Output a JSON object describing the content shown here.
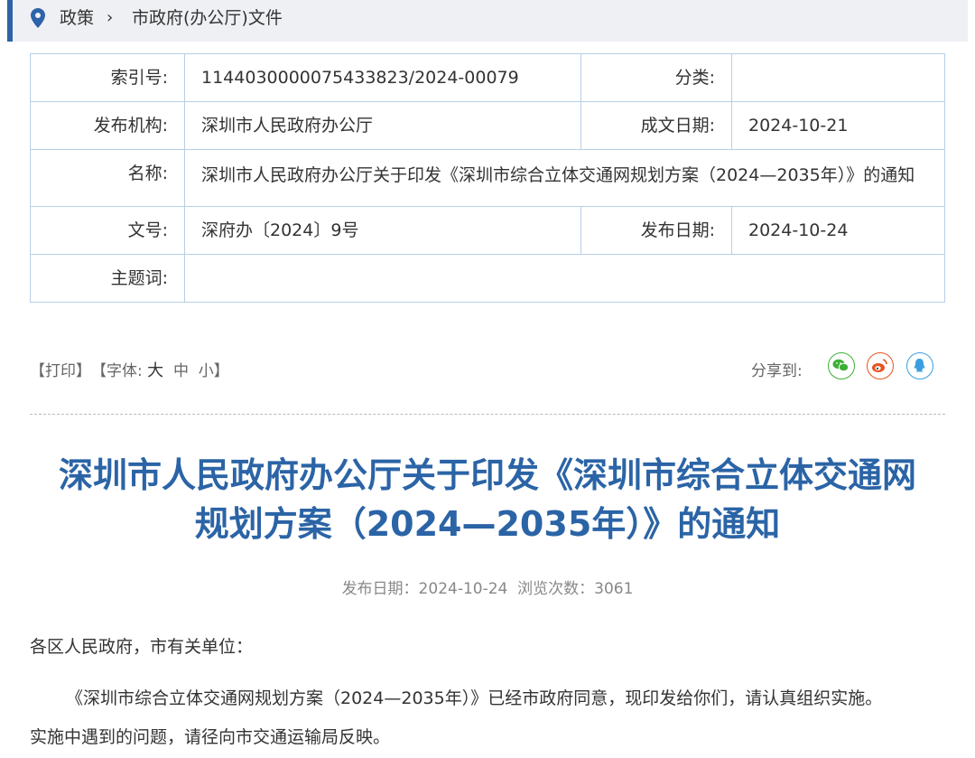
{
  "breadcrumb": {
    "items": [
      "政策",
      "市政府(办公厅)文件"
    ],
    "separator": "›"
  },
  "meta": {
    "index_label": "索引号:",
    "index_value": "11440300000754338​23/2024-00079",
    "category_label": "分类:",
    "category_value": "",
    "issuer_label": "发布机构:",
    "issuer_value": "深圳市人民政府办公厅",
    "written_date_label": "成文日期:",
    "written_date_value": "2024-10-21",
    "name_label": "名称:",
    "name_value": "深圳市人民政府办公厅关于印发《深圳市综合立体交通网规划方案（2024—2035年）》的通知",
    "docno_label": "文号:",
    "docno_value": "深府办〔2024〕9号",
    "pub_date_label": "发布日期:",
    "pub_date_value": "2024-10-24",
    "keywords_label": "主题词:",
    "keywords_value": ""
  },
  "tools": {
    "print": "【打印】",
    "font_prefix": "【字体:",
    "font_large": "大",
    "font_medium": "中",
    "font_small": "小",
    "font_suffix": "】",
    "share_label": "分享到:",
    "share_icons": [
      "wechat-icon",
      "weibo-icon",
      "qq-icon"
    ]
  },
  "article": {
    "title_line1": "深圳市人民政府办公厅关于印发《深圳市综合立体交通网",
    "title_line2": "规划方案（2024—2035年）》的通知",
    "publish_info": "发布日期：2024-10-24  浏览次数：3061",
    "salutation": "各区人民政府，市有关单位：",
    "para1_line1": "《深圳市综合立体交通网规划方案（2024—2035年）》已经市政府同意，现印发给你们，请认真组织实施。",
    "para1_line2": "实施中遇到的问题，请径向市交通运输局反映。"
  },
  "colors": {
    "accent": "#2d63a8",
    "title": "#2b64a6",
    "wechat": "#3cb034",
    "weibo": "#e8531f",
    "qq": "#3b9ee0"
  }
}
